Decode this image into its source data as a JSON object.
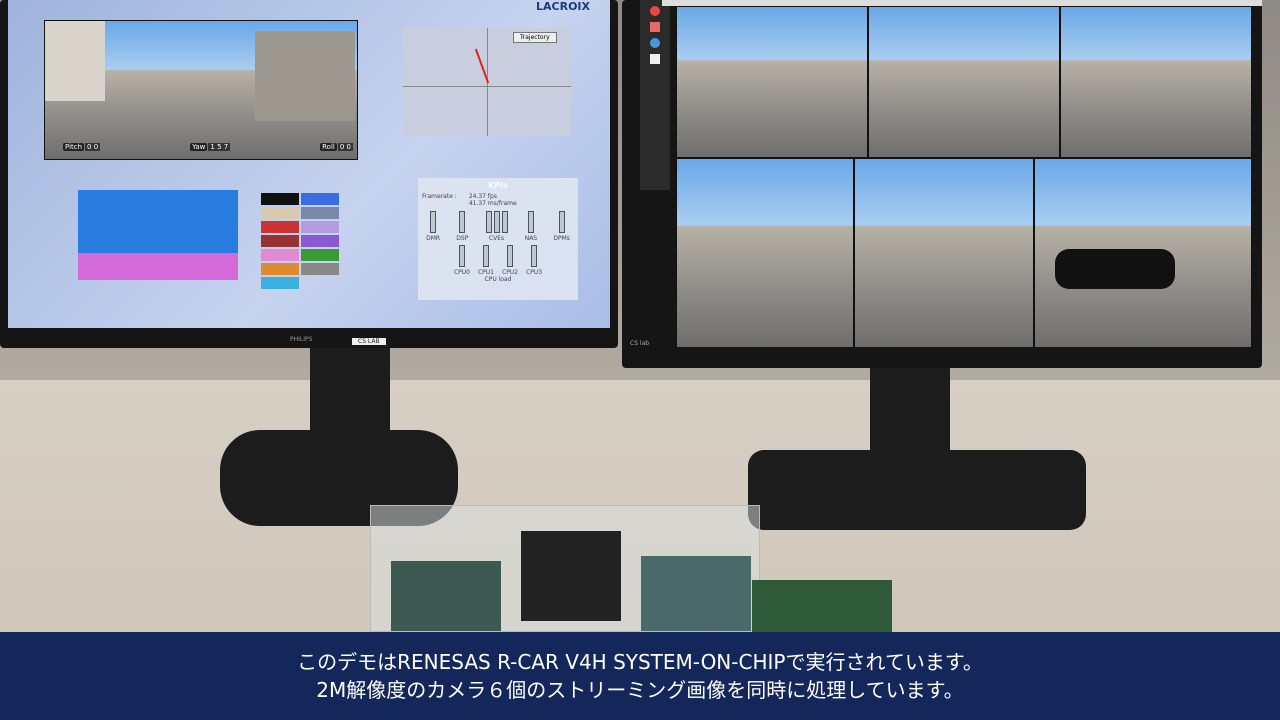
{
  "left_screen": {
    "brand": "LACROIX",
    "trajectory_button": "Trajectory",
    "pose": [
      {
        "label": "Pitch",
        "value": "0 0"
      },
      {
        "label": "Yaw",
        "value": "1 5 7"
      },
      {
        "label": "Roll",
        "value": "0 0"
      }
    ],
    "kpi": {
      "title": "KPIs",
      "framerate_label": "Framerate :",
      "fps": "24.37 fps",
      "ms": "41.37 ms/frame",
      "units": [
        "DMR",
        "DSP",
        "CVEs",
        "NAS",
        "DPMs"
      ],
      "cpus": [
        "CPU0",
        "CPU1",
        "CPU2",
        "CPU3"
      ],
      "cpu_load": "CPU load"
    }
  },
  "monitor_labels": {
    "left_brand": "PHILIPS",
    "left_sticker": "CS LAB",
    "right_sticker": "CS lab"
  },
  "subtitle": {
    "line1": "このデモはRENESAS R-CAR V4H SYSTEM-ON-CHIPで実行されています。",
    "line2": "2M解像度のカメラ６個のストリーミング画像を同時に処理しています。"
  },
  "colors": {
    "subtitle_bg": "#14275a"
  }
}
